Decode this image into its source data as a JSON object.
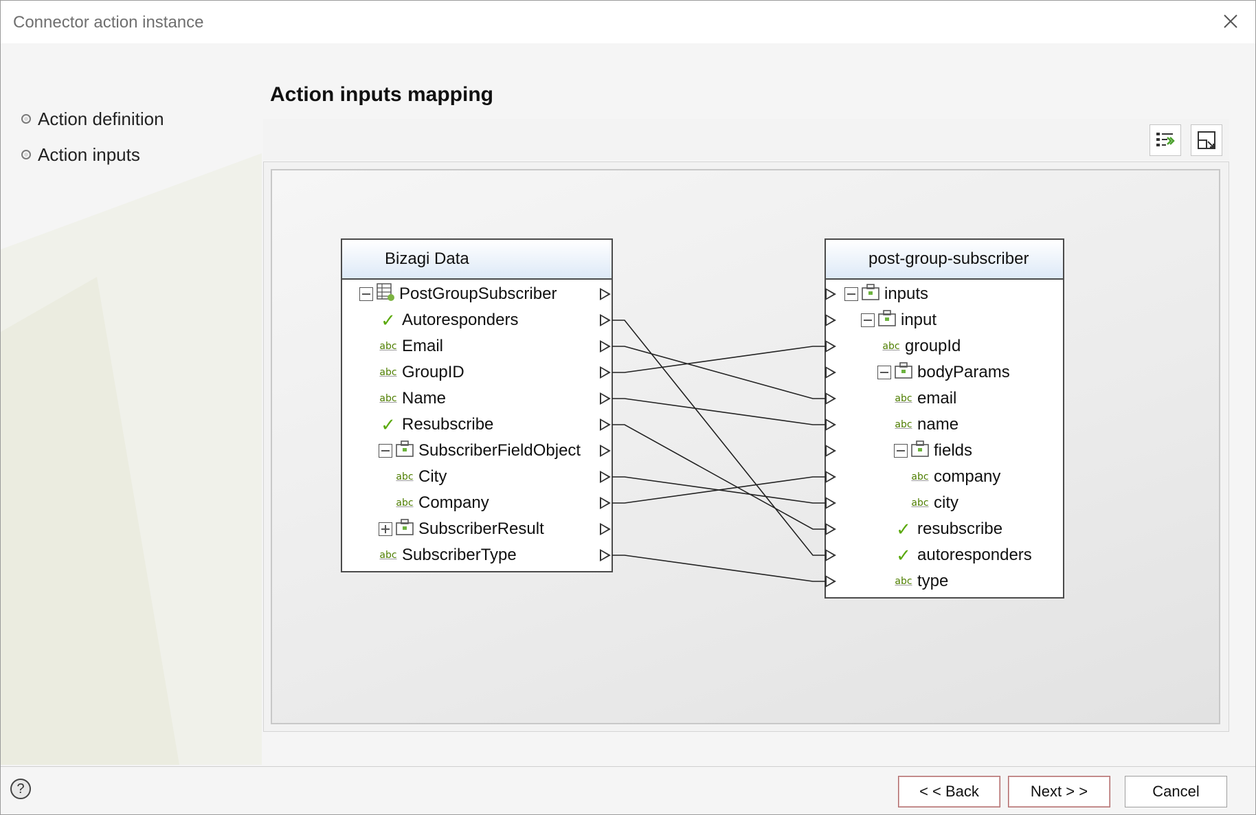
{
  "window": {
    "title": "Connector action instance",
    "close_icon": "close-icon"
  },
  "sidebar": {
    "steps": [
      {
        "label": "Action definition"
      },
      {
        "label": "Action inputs"
      }
    ]
  },
  "main": {
    "section_title": "Action inputs mapping",
    "toolbar": {
      "buttons": [
        {
          "icon": "auto-map-icon"
        },
        {
          "icon": "fit-view-icon"
        }
      ]
    }
  },
  "mapping": {
    "source": {
      "title": "Bizagi Data",
      "rows": [
        {
          "label": "PostGroupSubscriber",
          "icon": "entity-table-icon",
          "toggle": "expanded"
        },
        {
          "label": "Autoresponders",
          "icon": "boolean-check-icon"
        },
        {
          "label": "Email",
          "icon": "string-abc-icon"
        },
        {
          "label": "GroupID",
          "icon": "string-abc-icon"
        },
        {
          "label": "Name",
          "icon": "string-abc-icon"
        },
        {
          "label": "Resubscribe",
          "icon": "boolean-check-icon"
        },
        {
          "label": "SubscriberFieldObject",
          "icon": "object-icon",
          "toggle": "expanded"
        },
        {
          "label": "City",
          "icon": "string-abc-icon"
        },
        {
          "label": "Company",
          "icon": "string-abc-icon"
        },
        {
          "label": "SubscriberResult",
          "icon": "object-icon",
          "toggle": "collapsed"
        },
        {
          "label": "SubscriberType",
          "icon": "string-abc-icon"
        }
      ]
    },
    "target": {
      "title": "post-group-subscriber",
      "rows": [
        {
          "label": "inputs",
          "icon": "object-icon",
          "toggle": "expanded"
        },
        {
          "label": "input",
          "icon": "object-icon",
          "toggle": "expanded"
        },
        {
          "label": "groupId",
          "icon": "string-abc-icon"
        },
        {
          "label": "bodyParams",
          "icon": "object-icon",
          "toggle": "expanded"
        },
        {
          "label": "email",
          "icon": "string-abc-icon"
        },
        {
          "label": "name",
          "icon": "string-abc-icon"
        },
        {
          "label": "fields",
          "icon": "object-icon",
          "toggle": "expanded"
        },
        {
          "label": "company",
          "icon": "string-abc-icon"
        },
        {
          "label": "city",
          "icon": "string-abc-icon"
        },
        {
          "label": "resubscribe",
          "icon": "boolean-check-icon"
        },
        {
          "label": "autoresponders",
          "icon": "boolean-check-icon"
        },
        {
          "label": "type",
          "icon": "string-abc-icon"
        }
      ]
    },
    "links": [
      {
        "from": "Autoresponders",
        "to": "autoresponders"
      },
      {
        "from": "Email",
        "to": "email"
      },
      {
        "from": "GroupID",
        "to": "groupId"
      },
      {
        "from": "Name",
        "to": "name"
      },
      {
        "from": "Resubscribe",
        "to": "resubscribe"
      },
      {
        "from": "City",
        "to": "city"
      },
      {
        "from": "Company",
        "to": "company"
      },
      {
        "from": "SubscriberType",
        "to": "type"
      }
    ]
  },
  "footer": {
    "help_icon": "help-icon",
    "help_glyph": "?",
    "back_label": "< < Back",
    "next_label": "Next > >",
    "cancel_label": "Cancel"
  }
}
